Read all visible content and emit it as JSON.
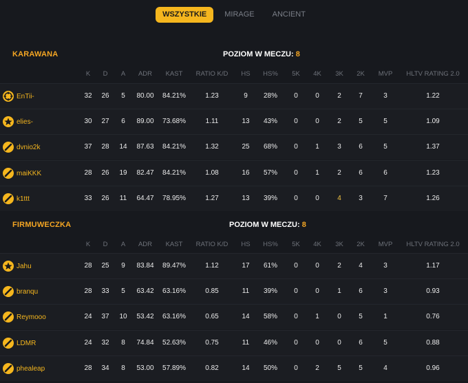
{
  "tabs": [
    {
      "label": "WSZYSTKIE",
      "active": true
    },
    {
      "label": "MIRAGE",
      "active": false
    },
    {
      "label": "ANCIENT",
      "active": false
    }
  ],
  "level_label": "POZIOM W MECZU:",
  "columns": [
    "K",
    "D",
    "A",
    "ADR",
    "KAST",
    "RATIO K/D",
    "HS",
    "HS%",
    "5K",
    "4K",
    "3K",
    "2K",
    "MVP",
    "HLTV RATING 2.0"
  ],
  "teams": [
    {
      "name": "KARAWANA",
      "level": "8",
      "players": [
        {
          "name": "EnTii-",
          "icon": "crosshair-icon",
          "stats": [
            "32",
            "26",
            "5",
            "80.00",
            "84.21%",
            "1.23",
            "9",
            "28%",
            "0",
            "0",
            "2",
            "7",
            "3",
            "1.22"
          ]
        },
        {
          "name": "elies-",
          "icon": "star-icon",
          "stats": [
            "30",
            "27",
            "6",
            "89.00",
            "73.68%",
            "1.11",
            "13",
            "43%",
            "0",
            "0",
            "2",
            "5",
            "5",
            "1.09"
          ]
        },
        {
          "name": "dvnio2k",
          "icon": "stripe-icon",
          "stats": [
            "37",
            "28",
            "14",
            "87.63",
            "84.21%",
            "1.32",
            "25",
            "68%",
            "0",
            "1",
            "3",
            "6",
            "5",
            "1.37"
          ]
        },
        {
          "name": "maiKKK",
          "icon": "stripe-icon",
          "stats": [
            "28",
            "26",
            "19",
            "82.47",
            "84.21%",
            "1.08",
            "16",
            "57%",
            "0",
            "1",
            "2",
            "6",
            "6",
            "1.23"
          ]
        },
        {
          "name": "k1ttt",
          "icon": "stripe-icon",
          "stats": [
            "33",
            "26",
            "11",
            "64.47",
            "78.95%",
            "1.27",
            "13",
            "39%",
            "0",
            "0",
            "4",
            "3",
            "7",
            "1.26"
          ]
        }
      ]
    },
    {
      "name": "FIRMUWECZKA",
      "level": "8",
      "players": [
        {
          "name": "Jahu",
          "icon": "star-icon",
          "stats": [
            "28",
            "25",
            "9",
            "83.84",
            "89.47%",
            "1.12",
            "17",
            "61%",
            "0",
            "0",
            "2",
            "4",
            "3",
            "1.17"
          ]
        },
        {
          "name": "branqu",
          "icon": "stripe-icon",
          "stats": [
            "28",
            "33",
            "5",
            "63.42",
            "63.16%",
            "0.85",
            "11",
            "39%",
            "0",
            "0",
            "1",
            "6",
            "3",
            "0.93"
          ]
        },
        {
          "name": "Reymooo",
          "icon": "stripe-icon",
          "stats": [
            "24",
            "37",
            "10",
            "53.42",
            "63.16%",
            "0.65",
            "14",
            "58%",
            "0",
            "1",
            "0",
            "5",
            "1",
            "0.76"
          ]
        },
        {
          "name": "LDMR",
          "icon": "stripe-icon",
          "stats": [
            "24",
            "32",
            "8",
            "74.84",
            "52.63%",
            "0.75",
            "11",
            "46%",
            "0",
            "0",
            "0",
            "6",
            "5",
            "0.88"
          ]
        },
        {
          "name": "phealeap",
          "icon": "stripe-icon",
          "stats": [
            "28",
            "34",
            "8",
            "53.00",
            "57.89%",
            "0.82",
            "14",
            "50%",
            "0",
            "2",
            "5",
            "5",
            "4",
            "0.96"
          ]
        }
      ]
    }
  ],
  "colors": {
    "accent": "#f5b61e",
    "team": "#f5a623",
    "background": "#17191e",
    "row": "#1b1d22"
  }
}
